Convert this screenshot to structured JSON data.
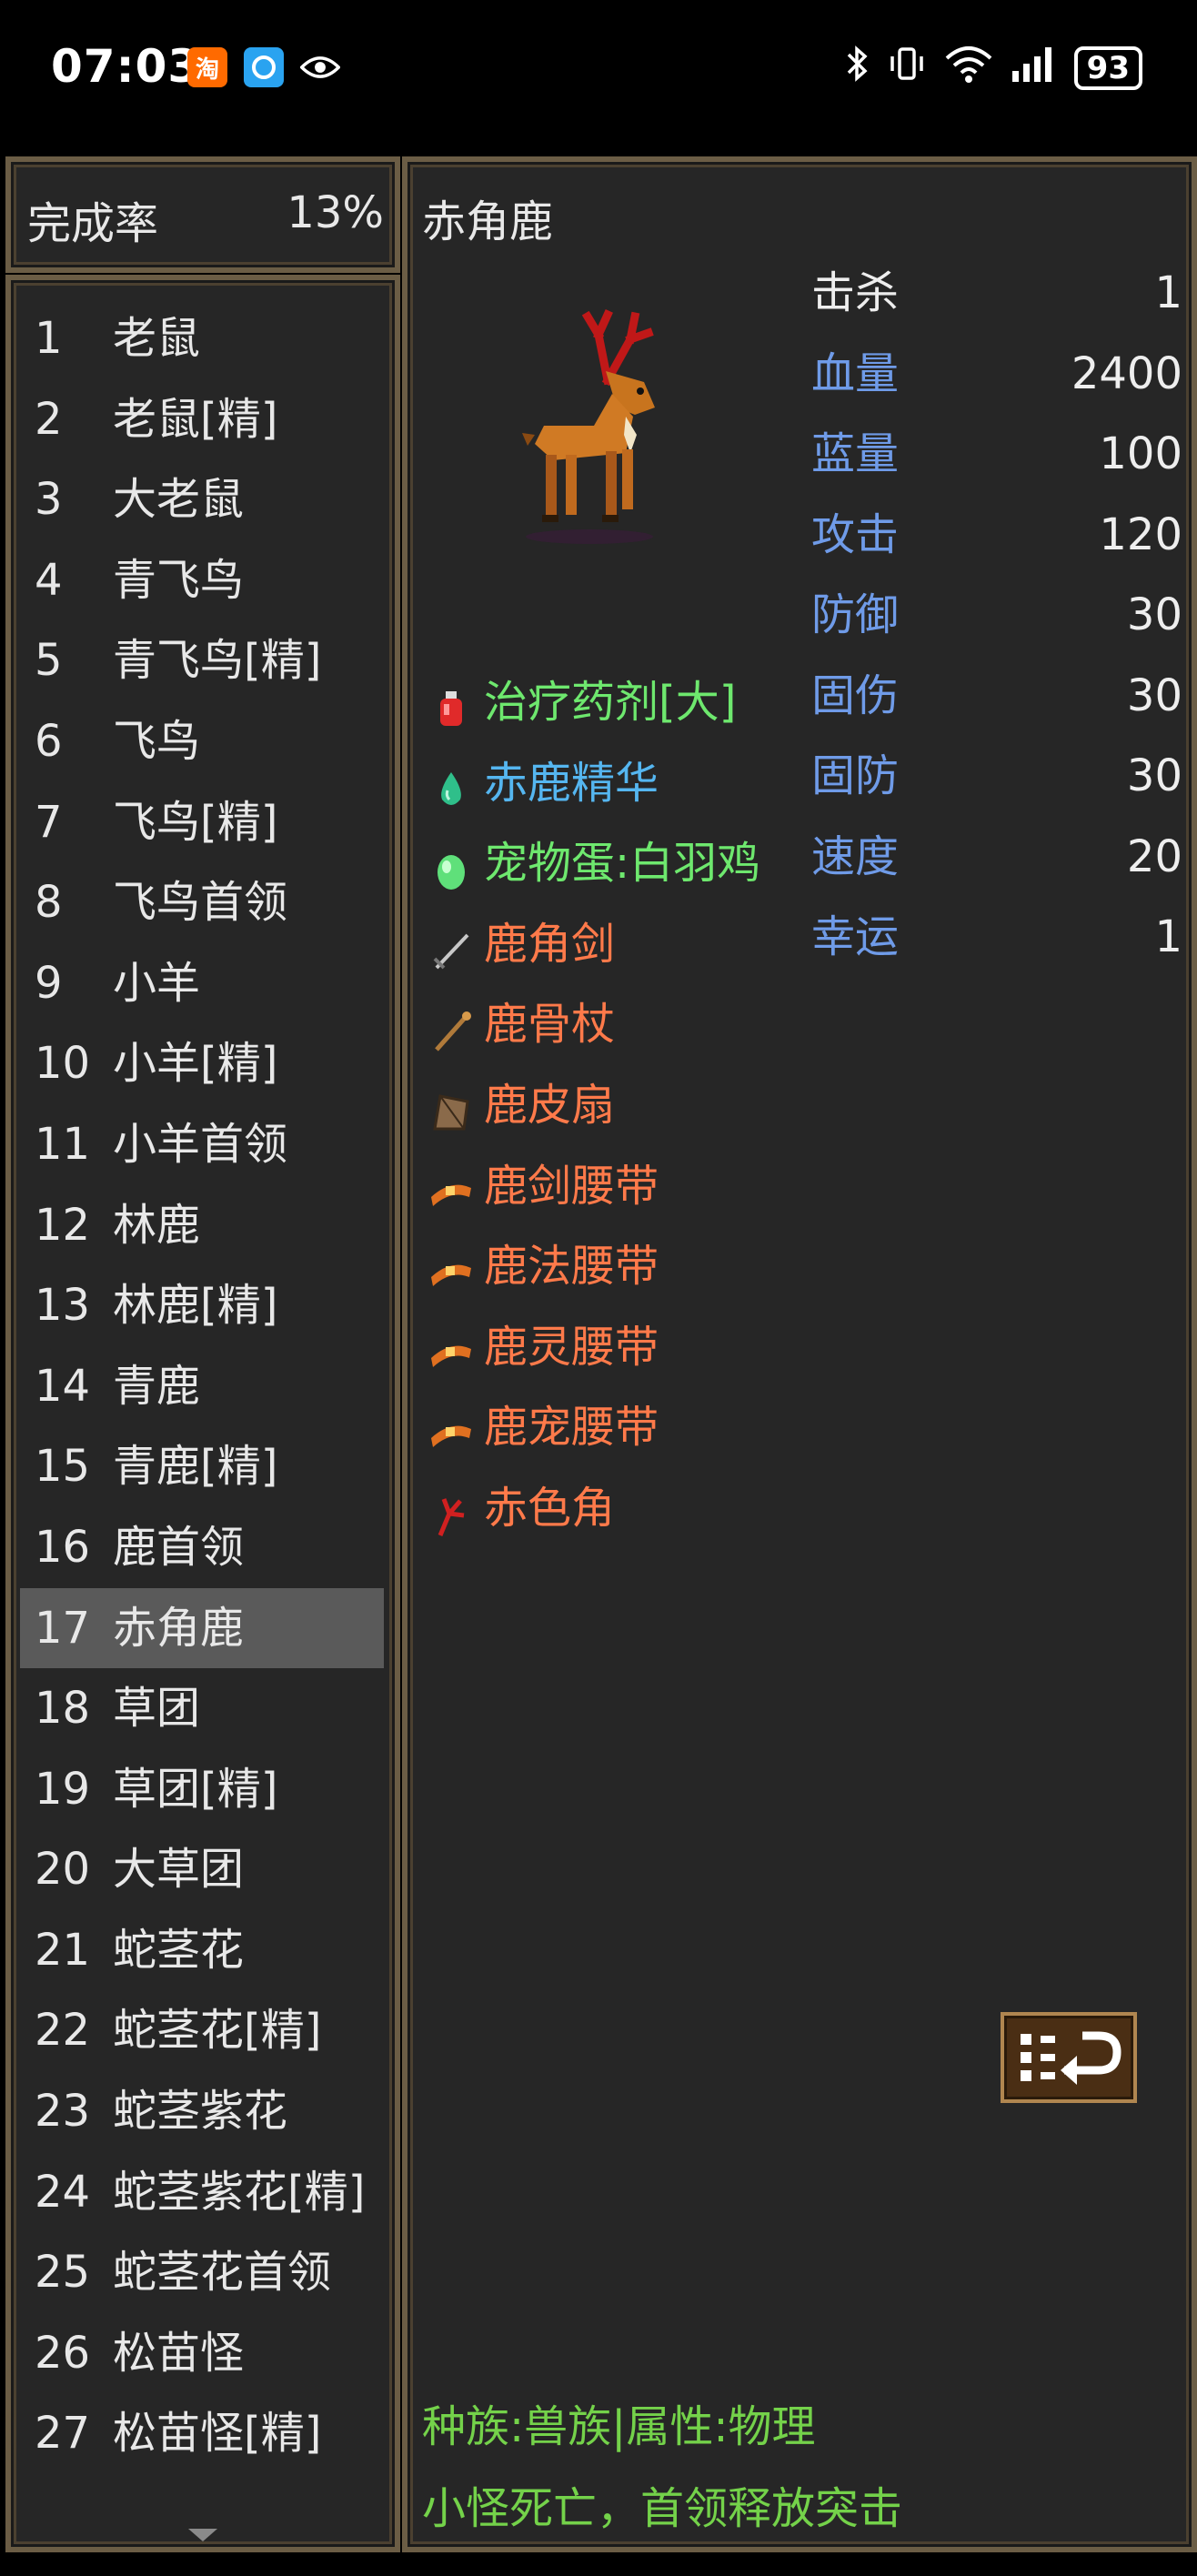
{
  "status_bar": {
    "time": "07:03",
    "battery": "93",
    "taobao_glyph": "淘"
  },
  "completion": {
    "label": "完成率",
    "value": "13%"
  },
  "monster_list": [
    {
      "num": "1",
      "name": "老鼠"
    },
    {
      "num": "2",
      "name": "老鼠[精]"
    },
    {
      "num": "3",
      "name": "大老鼠"
    },
    {
      "num": "4",
      "name": "青飞鸟"
    },
    {
      "num": "5",
      "name": "青飞鸟[精]"
    },
    {
      "num": "6",
      "name": "飞鸟"
    },
    {
      "num": "7",
      "name": "飞鸟[精]"
    },
    {
      "num": "8",
      "name": "飞鸟首领"
    },
    {
      "num": "9",
      "name": "小羊"
    },
    {
      "num": "10",
      "name": "小羊[精]"
    },
    {
      "num": "11",
      "name": "小羊首领"
    },
    {
      "num": "12",
      "name": "林鹿"
    },
    {
      "num": "13",
      "name": "林鹿[精]"
    },
    {
      "num": "14",
      "name": "青鹿"
    },
    {
      "num": "15",
      "name": "青鹿[精]"
    },
    {
      "num": "16",
      "name": "鹿首领"
    },
    {
      "num": "17",
      "name": "赤角鹿",
      "selected": true
    },
    {
      "num": "18",
      "name": "草团"
    },
    {
      "num": "19",
      "name": "草团[精]"
    },
    {
      "num": "20",
      "name": "大草团"
    },
    {
      "num": "21",
      "name": "蛇茎花"
    },
    {
      "num": "22",
      "name": "蛇茎花[精]"
    },
    {
      "num": "23",
      "name": "蛇茎紫花"
    },
    {
      "num": "24",
      "name": "蛇茎紫花[精]"
    },
    {
      "num": "25",
      "name": "蛇茎花首领"
    },
    {
      "num": "26",
      "name": "松苗怪"
    },
    {
      "num": "27",
      "name": "松苗怪[精]"
    }
  ],
  "detail": {
    "name": "赤角鹿",
    "stats": [
      {
        "label": "击杀",
        "value": "1",
        "style": "white"
      },
      {
        "label": "血量",
        "value": "2400",
        "style": "blue"
      },
      {
        "label": "蓝量",
        "value": "100",
        "style": "blue"
      },
      {
        "label": "攻击",
        "value": "120",
        "style": "blue"
      },
      {
        "label": "防御",
        "value": "30",
        "style": "blue"
      },
      {
        "label": "固伤",
        "value": "30",
        "style": "blue"
      },
      {
        "label": "固防",
        "value": "30",
        "style": "blue"
      },
      {
        "label": "速度",
        "value": "20",
        "style": "blue"
      },
      {
        "label": "幸运",
        "value": "1",
        "style": "blue"
      }
    ],
    "drops": [
      {
        "name": "治疗药剂[大]",
        "color": "green",
        "icon": "potion-icon"
      },
      {
        "name": "赤鹿精华",
        "color": "cyan",
        "icon": "essence-drop-icon"
      },
      {
        "name": "宠物蛋:白羽鸡",
        "color": "green",
        "icon": "pet-egg-icon"
      },
      {
        "name": "鹿角剑",
        "color": "orange",
        "icon": "sword-icon"
      },
      {
        "name": "鹿骨杖",
        "color": "orange",
        "icon": "staff-icon"
      },
      {
        "name": "鹿皮扇",
        "color": "orange",
        "icon": "fan-icon"
      },
      {
        "name": "鹿剑腰带",
        "color": "orange",
        "icon": "belt-icon"
      },
      {
        "name": "鹿法腰带",
        "color": "orange",
        "icon": "belt-icon"
      },
      {
        "name": "鹿灵腰带",
        "color": "orange",
        "icon": "belt-icon"
      },
      {
        "name": "鹿宠腰带",
        "color": "orange",
        "icon": "belt-icon"
      },
      {
        "name": "赤色角",
        "color": "orange",
        "icon": "red-horn-icon"
      }
    ],
    "footer": {
      "line1": "种族:兽族|属性:物理",
      "line2": "小怪死亡，首领释放突击"
    }
  },
  "colors": {
    "stat_blue": "#6f9be8",
    "drop_green": "#6ee86e",
    "drop_cyan": "#55b6f0",
    "drop_orange": "#ff7a4a",
    "footer_green": "#74d24a",
    "frame_border": "#6b5d45"
  }
}
